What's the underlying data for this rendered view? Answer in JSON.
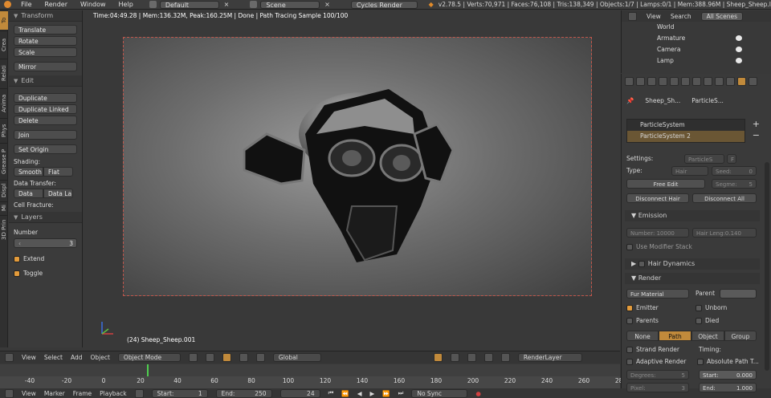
{
  "topbar": {
    "menus": [
      "File",
      "Render",
      "Window",
      "Help"
    ],
    "layout": "Default",
    "scene": "Scene",
    "engine": "Cycles Render",
    "stats": "v2.78.5 | Verts:70,971 | Faces:76,108 | Tris:138,349 | Objects:1/7 | Lamps:0/1 | Mem:388.96M | Sheep_Sheep.I"
  },
  "left_tabs": [
    "To",
    "Crea",
    "Relati",
    "Anima",
    "Phys",
    "Grease P",
    "Displ",
    "Mi",
    "3D Prin"
  ],
  "shelf": {
    "transform_title": "Transform",
    "transform_buttons": [
      "Translate",
      "Rotate",
      "Scale",
      "Mirror"
    ],
    "edit_title": "Edit",
    "edit_buttons": [
      "Duplicate",
      "Duplicate Linked",
      "Delete",
      "Join",
      "Set Origin"
    ],
    "shading_label": "Shading:",
    "shading_smooth": "Smooth",
    "shading_flat": "Flat",
    "data_transfer_label": "Data Transfer:",
    "data_btn": "Data",
    "data_la_btn": "Data La",
    "cell_fracture_label": "Cell Fracture:",
    "layers_title": "Layers",
    "number_label": "Number",
    "number_value": "3",
    "extend_label": "Extend",
    "toggle_label": "Toggle"
  },
  "viewport": {
    "render_info": "Time:04:49.28 | Mem:136.32M, Peak:160.25M | Done | Path Tracing Sample 100/100",
    "object_label": "(24) Sheep_Sheep.001"
  },
  "viewport_header": {
    "view": "View",
    "select": "Select",
    "add": "Add",
    "object": "Object",
    "mode": "Object Mode",
    "orientation": "Global",
    "render_layer": "RenderLayer"
  },
  "timeline": {
    "ticks": [
      -40,
      -20,
      0,
      20,
      40,
      60,
      80,
      100,
      120,
      140,
      160,
      180,
      200,
      220,
      240,
      260,
      280
    ],
    "current_frame": 24,
    "view": "View",
    "marker": "Marker",
    "frame": "Frame",
    "playback": "Playback",
    "start_label": "Start:",
    "start_value": "1",
    "end_label": "End:",
    "end_value": "250",
    "current": "24",
    "sync": "No Sync"
  },
  "outliner": {
    "view": "View",
    "search": "Search",
    "all_scenes": "All Scenes",
    "items": [
      "World",
      "Armature",
      "Camera",
      "Lamp"
    ]
  },
  "properties": {
    "breadcrumb_obj": "Sheep_Sh...",
    "breadcrumb_ps": "ParticleS...",
    "systems": [
      "ParticleSystem",
      "ParticleSystem 2"
    ],
    "settings_label": "Settings:",
    "settings_value": "ParticleS",
    "settings_f": "F",
    "type_label": "Type:",
    "type_value": "Hair",
    "seed": "Seed:",
    "seed_value": "0",
    "free_edit": "Free Edit",
    "segments": "Segme:",
    "segments_value": "5",
    "disconnect_hair": "Disconnect Hair",
    "disconnect_all": "Disconnect All",
    "emission_title": "Emission",
    "number": "Number: 10000",
    "hair_length": "Hair Leng:0.140",
    "use_modifier_stack": "Use Modifier Stack",
    "hair_dynamics_title": "Hair Dynamics",
    "render_title": "Render",
    "material": "Fur Material",
    "parent_label": "Parent",
    "emitter": "Emitter",
    "unborn": "Unborn",
    "parents": "Parents",
    "died": "Died",
    "render_modes": [
      "None",
      "Path",
      "Object",
      "Group"
    ],
    "strand_render": "Strand Render",
    "timing": "Timing:",
    "adaptive_render": "Adaptive Render",
    "absolute_path": "Absolute Path T...",
    "degrees": "Degrees:",
    "degrees_value": "5",
    "start": "Start:",
    "start_value": "0.000",
    "pixel": "Pixel:",
    "pixel_value": "3",
    "end": "End:",
    "end_value": "1.000"
  }
}
